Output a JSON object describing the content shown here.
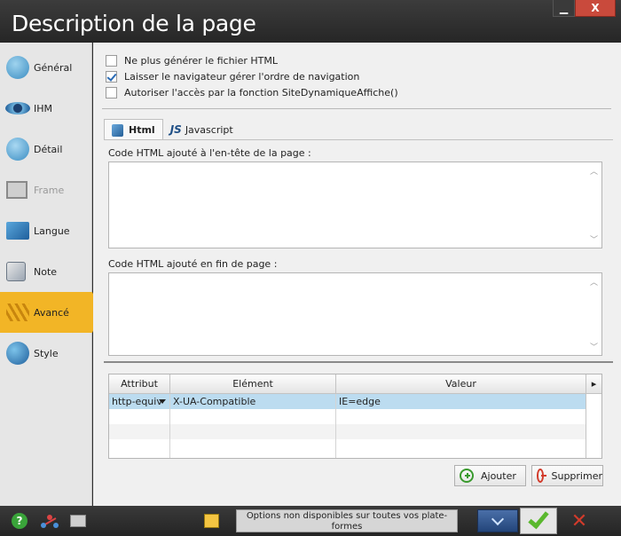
{
  "window": {
    "title": "Description de la page",
    "minimize": "▁",
    "close": "X"
  },
  "sidebar": {
    "items": [
      {
        "label": "Général",
        "icon": "general-icon"
      },
      {
        "label": "IHM",
        "icon": "eye-icon"
      },
      {
        "label": "Détail",
        "icon": "detail-icon"
      },
      {
        "label": "Frame",
        "icon": "frame-icon",
        "disabled": true
      },
      {
        "label": "Langue",
        "icon": "flag-icon"
      },
      {
        "label": "Note",
        "icon": "note-icon"
      },
      {
        "label": "Avancé",
        "icon": "advanced-icon",
        "active": true
      },
      {
        "label": "Style",
        "icon": "palette-icon"
      }
    ]
  },
  "options": {
    "no_html": {
      "label": "Ne plus générer le fichier HTML",
      "checked": false
    },
    "browser_nav": {
      "label": "Laisser le navigateur gérer l'ordre de navigation",
      "checked": true
    },
    "allow_access": {
      "label": "Autoriser l'accès par la fonction SiteDynamiqueAffiche()",
      "checked": false
    }
  },
  "tabs": {
    "html": "Html",
    "javascript": "Javascript",
    "js_badge": "JS"
  },
  "fields": {
    "header_label": "Code HTML ajouté à l'en-tête de la page :",
    "header_value": "",
    "footer_label": "Code HTML ajouté en fin de page :",
    "footer_value": ""
  },
  "table": {
    "columns": [
      "Attribut",
      "Elément",
      "Valeur"
    ],
    "rows": [
      {
        "attribut": "http-equiv",
        "element": "X-UA-Compatible",
        "valeur": "IE=edge"
      }
    ]
  },
  "buttons": {
    "add": "Ajouter",
    "delete": "Supprimer"
  },
  "bottom": {
    "info": "Options non disponibles sur toutes vos plate-formes"
  },
  "colors": {
    "accent": "#f2b526",
    "selection": "#bcdcf0",
    "ok": "#5ab82e",
    "cancel": "#d23b2b"
  }
}
